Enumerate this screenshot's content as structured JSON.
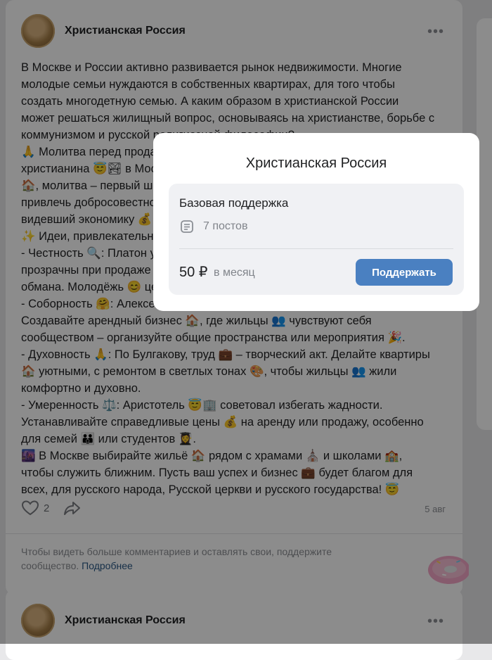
{
  "post": {
    "group_name": "Христианская Россия",
    "more_label": "•••",
    "lines": [
      "В Москве и России активно развивается рынок недвижимости. Многие",
      "молодые семьи нуждаются в собственных квартирах, для того чтобы",
      "создать многодетную семью. А каким образом в христианской России",
      "может решаться жилищный вопрос, основываясь на христианстве, борьбе с",
      "коммунизмом и русской религиозной философии?",
      "🙏 Молитва перед продажей квартиры – это первый шаг для",
      "христианина 😇🏞 в Москве. Обращение к Богу о помощи при покупке",
      "🏠, молитва – первый шаг к успешному бизнесу. Правильная цена может",
      "привлечь добросовестного покупателя, как советовал Булгаков,",
      "видевший экономику 💰 своими глазами.",
      "✨ Идеи, привлекательные для христиан:",
      "- Честность 🔍: Платон утверждал, что честность важна. Будьте",
      "прозрачны при продаже и аренде недвижимости, избегайте",
      "обмана. Молодёжь 😊 ценит честность.",
      "- Соборность 🤗: Алексей Хомяков считал соборность основой общества.",
      "Создавайте арендный бизнес 🏠, где жильцы 👥 чувствуют себя",
      "сообществом – организуйте общие пространства или мероприятия 🎉.",
      "- Духовность 🙏: По Булгакову, труд 💼 – творческий акт. Делайте квартиры",
      "🏠 уютными, с ремонтом в светлых тонах 🎨, чтобы жильцы 👥 жили",
      "комфортно и духовно.",
      "- Умеренность ⚖️: Аристотель 😇🏢 советовал избегать жадности.",
      "Устанавливайте справедливые цены 💰 на аренду или продажу, особенно",
      "для семей 👪 или студентов 👩‍🎓.",
      "🌆 В Москве выбирайте жильё 🏠 рядом с храмами ⛪ и школами 🏫,",
      "чтобы служить ближним. Пусть ваш успех и бизнес 💼 будет благом для",
      "всех, для русского народа, Русской церкви и русского государства! 😇"
    ],
    "likes": "2",
    "date": "5 авг"
  },
  "notice": {
    "text": "Чтобы видеть больше комментариев и оставлять свои, поддержите сообщество. ",
    "link": "Подробнее"
  },
  "next_post": {
    "group_name": "Христианская Россия",
    "more_label": "•••"
  },
  "modal": {
    "title": "Христианская Россия",
    "tier_name": "Базовая поддержка",
    "posts_count": "7 постов",
    "price": "50 ₽",
    "period": "в месяц",
    "button_label": "Поддержать"
  },
  "colors": {
    "accent": "#4a80c1",
    "link": "#2a5885",
    "overlay": "rgba(0,0,0,0.45)"
  }
}
